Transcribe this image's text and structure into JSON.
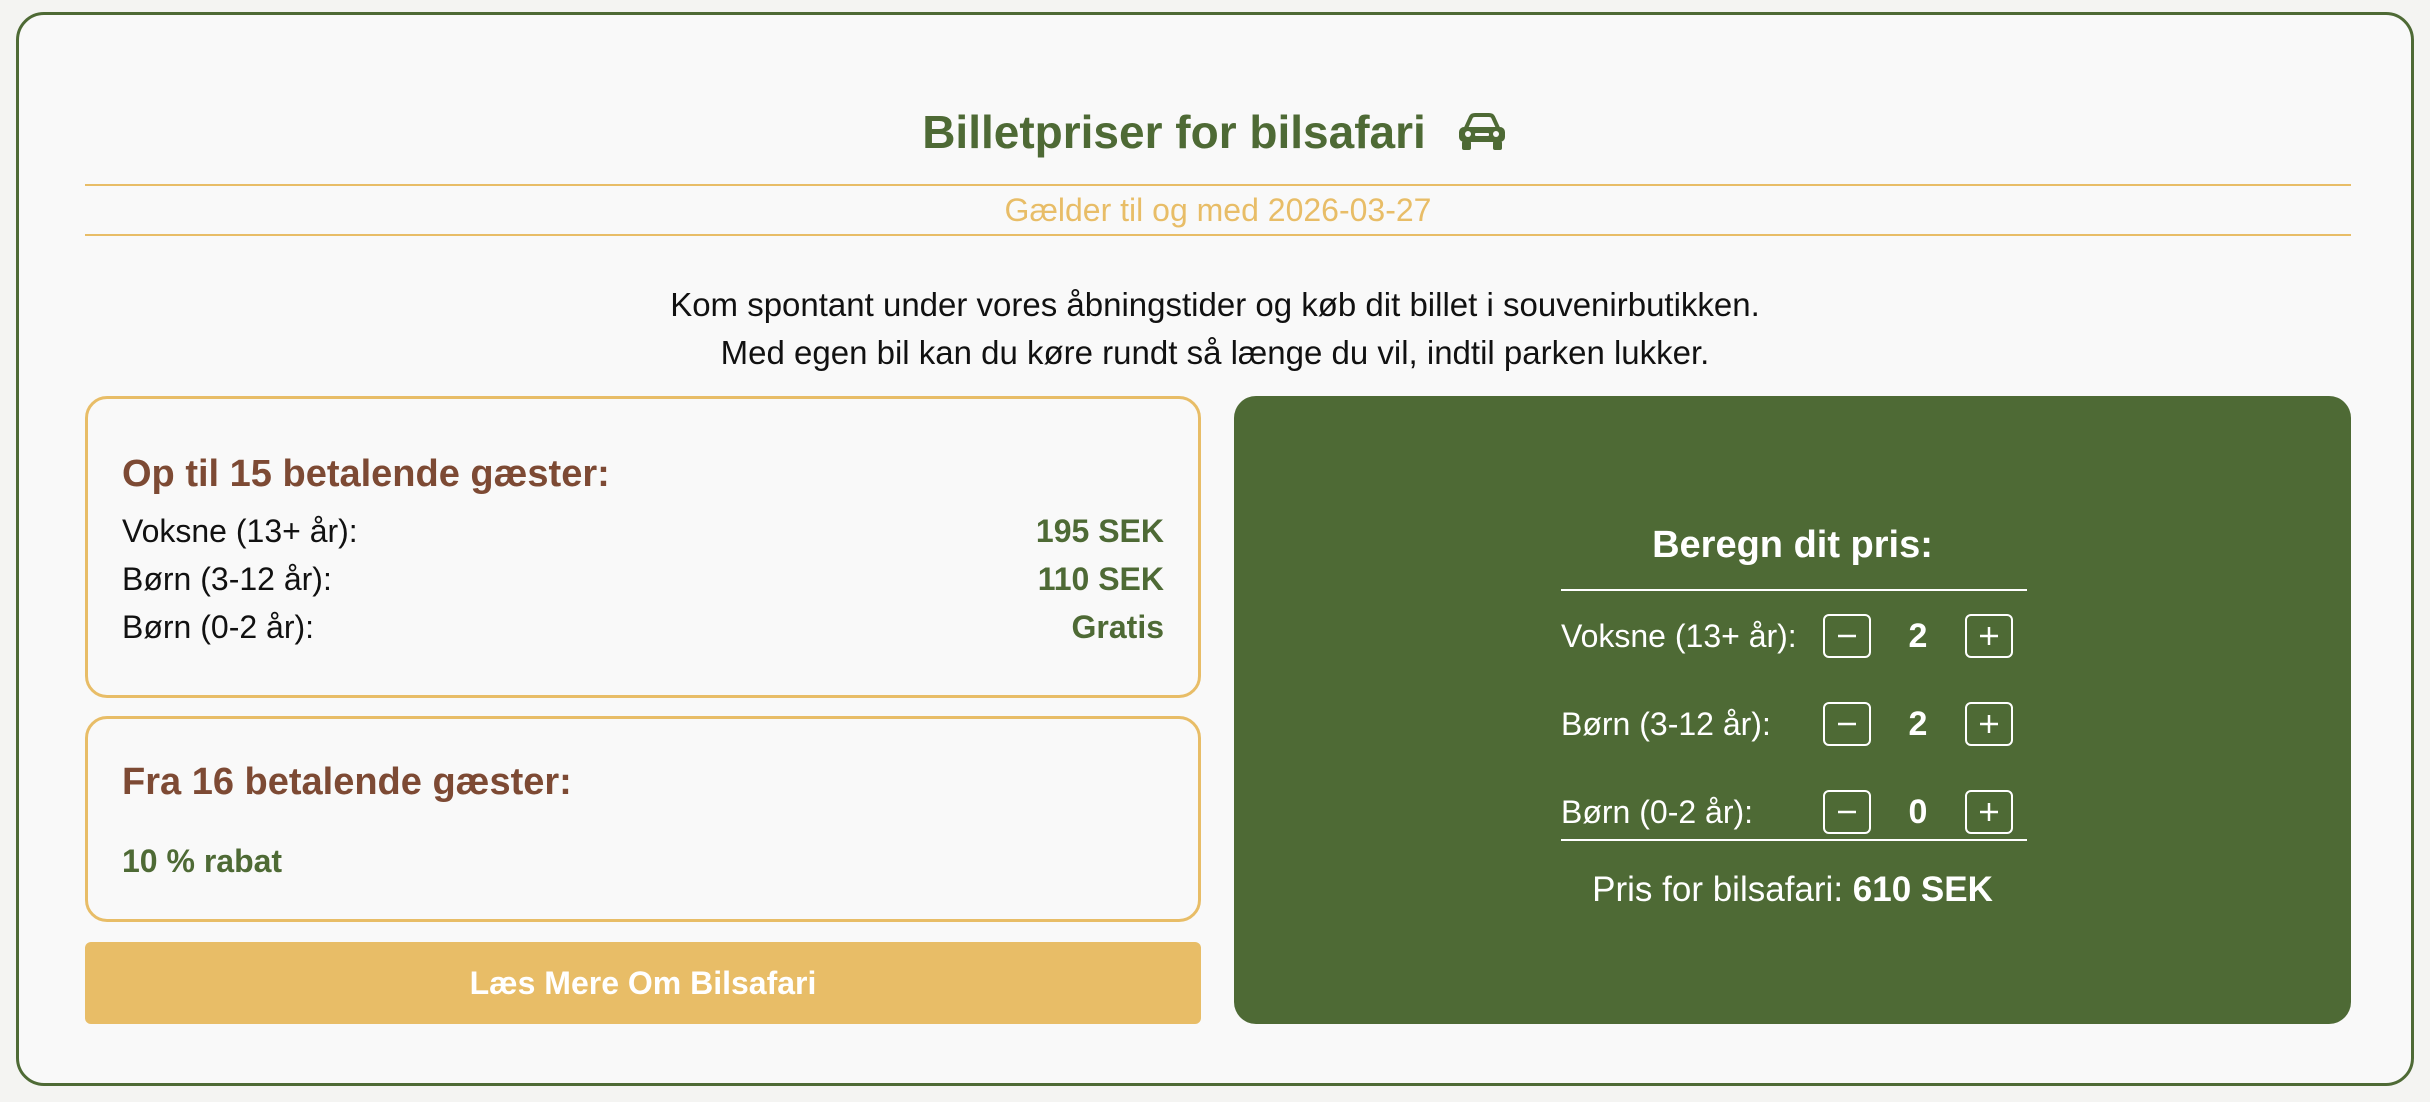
{
  "header": {
    "title": "Billetpriser for bilsafari",
    "title_icon": "car-icon",
    "valid_until": "Gælder til og med 2026-03-27"
  },
  "intro": {
    "line1": "Kom spontant under vores åbningstider og køb dit billet i souvenirbutikken.",
    "line2": "Med egen bil kan du køre rundt så længe du vil, indtil parken lukker."
  },
  "small_group": {
    "heading": "Op til 15 betalende gæster:",
    "rows": [
      {
        "label": "Voksne (13+ år):",
        "price": "195 SEK"
      },
      {
        "label": "Børn (3-12 år):",
        "price": "110 SEK"
      },
      {
        "label": "Børn (0-2 år):",
        "price": "Gratis"
      }
    ]
  },
  "large_group": {
    "heading": "Fra 16 betalende gæster:",
    "discount": "10 % rabat"
  },
  "cta": {
    "label": "Læs Mere Om Bilsafari"
  },
  "calculator": {
    "title": "Beregn dit pris:",
    "rows": [
      {
        "label": "Voksne (13+ år):",
        "count": "2"
      },
      {
        "label": "Børn (3-12 år):",
        "count": "2"
      },
      {
        "label": "Børn (0-2 år):",
        "count": "0"
      }
    ],
    "total_label": "Pris for bilsafari:",
    "total_value": "610 SEK"
  },
  "colors": {
    "brand_green": "#4e6a35",
    "accent_gold": "#e8bd67",
    "heading_brown": "#7d4a34"
  }
}
